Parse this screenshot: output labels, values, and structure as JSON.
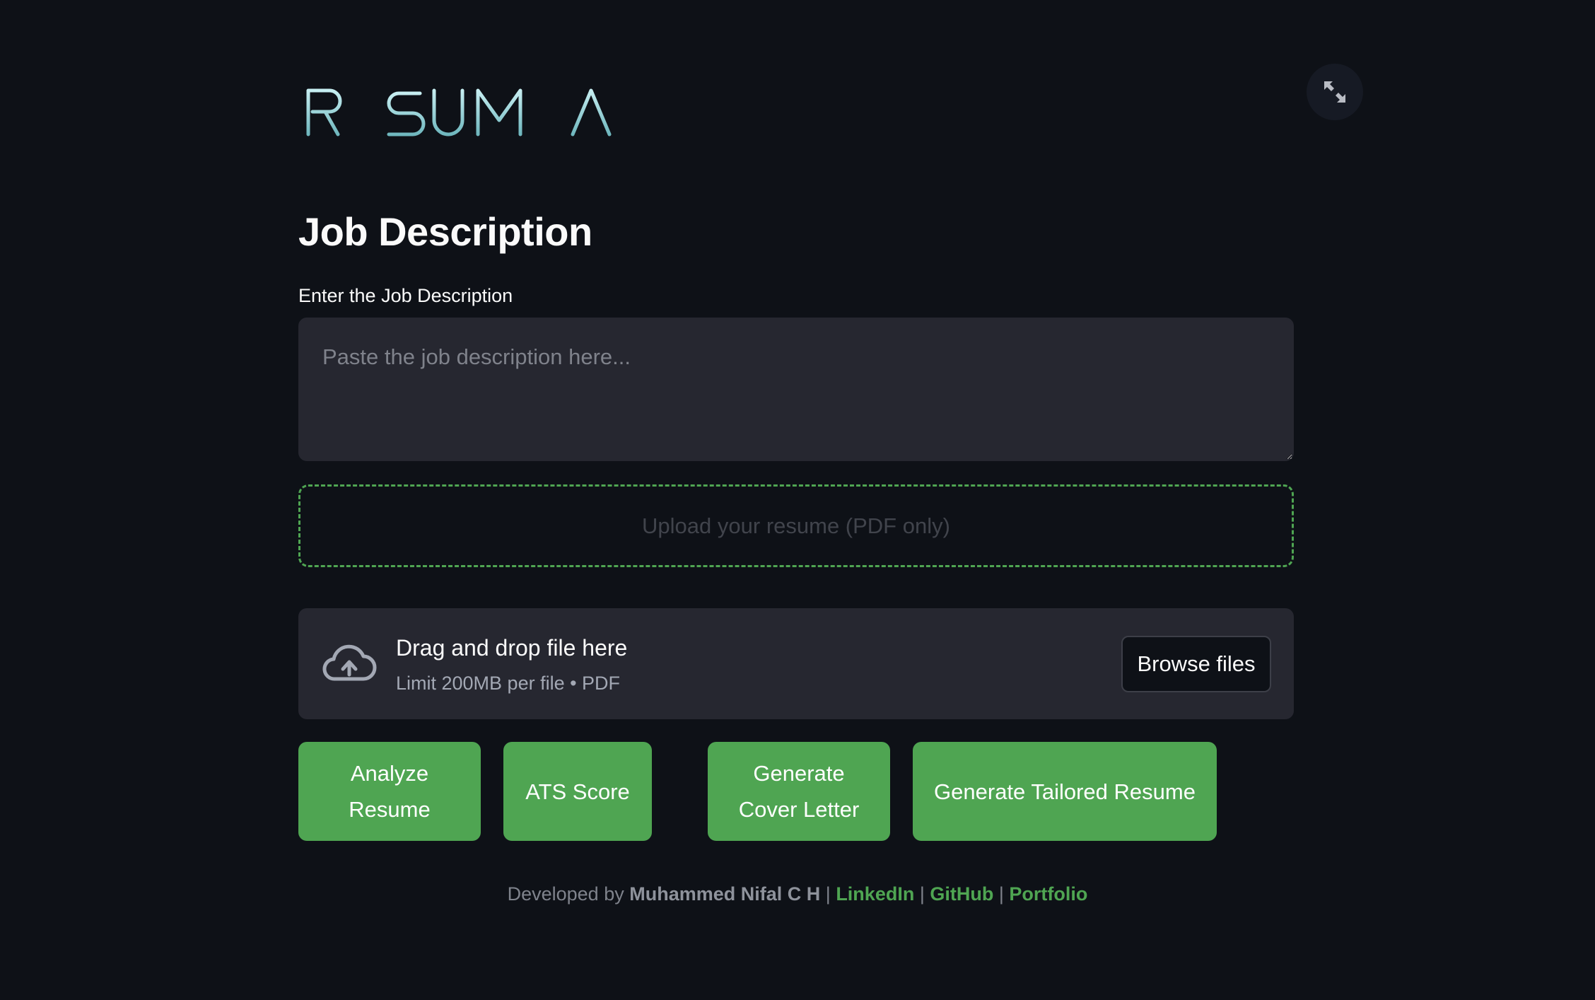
{
  "brand": {
    "logo_text": "RESUMEAI",
    "accent_color": "#4fa552",
    "logo_color": "#9fd3d8"
  },
  "toolbar": {
    "expand_icon": "fullscreen-expand-icon"
  },
  "main": {
    "heading": "Job Description",
    "job_description": {
      "label": "Enter the Job Description",
      "placeholder": "Paste the job description here...",
      "value": ""
    },
    "upload_prompt": "Upload your resume (PDF only)",
    "uploader": {
      "icon": "cloud-upload-icon",
      "title": "Drag and drop file here",
      "subtitle": "Limit 200MB per file • PDF",
      "browse_label": "Browse files"
    },
    "actions": {
      "analyze_line1": "Analyze",
      "analyze_line2": "Resume",
      "ats_score": "ATS Score",
      "cover_line1": "Generate",
      "cover_line2": "Cover Letter",
      "tailored": "Generate Tailored Resume"
    }
  },
  "footer": {
    "prefix": "Developed by",
    "author": "Muhammed Nifal C H",
    "separator": "|",
    "linkedin": "LinkedIn",
    "github": "GitHub",
    "portfolio": "Portfolio"
  }
}
